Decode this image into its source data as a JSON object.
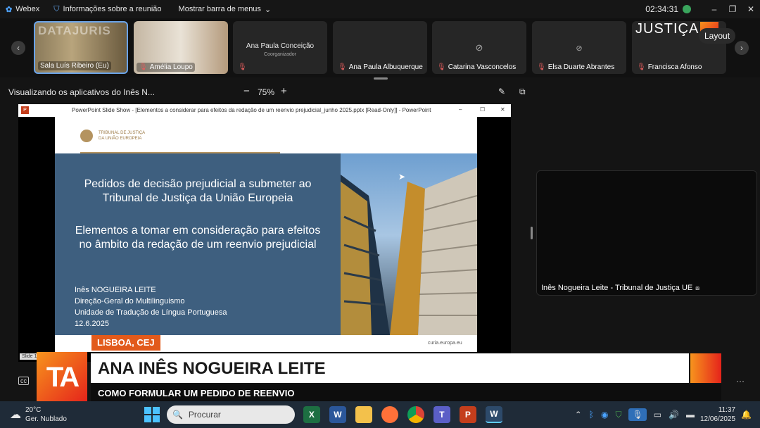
{
  "topbar": {
    "app_name": "Webex",
    "meeting_info": "Informações sobre a reunião",
    "show_menu": "Mostrar barra de menus",
    "timer": "02:34:31"
  },
  "participants": [
    {
      "name": "Sala Luís Ribeiro (Eu)"
    },
    {
      "name": "Amélia Loupo"
    },
    {
      "name": "Ana Paula Conceição",
      "role": "Coorganizador"
    },
    {
      "name": "Ana Paula Albuquerque"
    },
    {
      "name": "Catarina Vasconcelos"
    },
    {
      "name": "Elsa Duarte Abrantes"
    },
    {
      "name": "Francisca Afonso"
    }
  ],
  "watermark_left": "DATAJURIS",
  "brand_right": "JUSTIÇA",
  "layout_button": "Layout",
  "viewing": {
    "label": "Visualizando os aplicativos do Inês N...",
    "zoom": "75%"
  },
  "ppt": {
    "window_title": "PowerPoint Slide Show - [Elementos a considerar para efeitos da redação de um reenvio prejudicial_junho 2025.pptx [Read-Only]] - PowerPoint",
    "slide_indicator": "Slide 1"
  },
  "slide": {
    "logo_text_1": "TRIBUNAL DE JUSTIÇA",
    "logo_text_2": "DA UNIÃO EUROPEIA",
    "title_1": "Pedidos de decisão prejudicial a submeter ao Tribunal de Justiça da União Europeia",
    "title_2": "Elementos a tomar em consideração para efeitos no âmbito da redação de um reenvio prejudicial",
    "author": "Inês NOGUEIRA LEITE",
    "dept": "Direção-Geral do Multilinguismo",
    "unit": "Unidade de Tradução de Língua Portuguesa",
    "date": "12.6.2025",
    "footer_url": "curia.europa.eu"
  },
  "right_video": {
    "name": "Inês Nogueira Leite - Tribunal de Justiça UE"
  },
  "lower_third": {
    "location": "LISBOA, CEJ",
    "name": "ANA INÊS NOGUEIRA LEITE",
    "subtitle": "COMO FORMULAR UM PEDIDO DE REENVIO",
    "logo": "TA"
  },
  "taskbar": {
    "temp": "20°C",
    "weather": "Ger. Nublado",
    "search_placeholder": "Procurar",
    "time": "11:37",
    "date": "12/06/2025"
  }
}
